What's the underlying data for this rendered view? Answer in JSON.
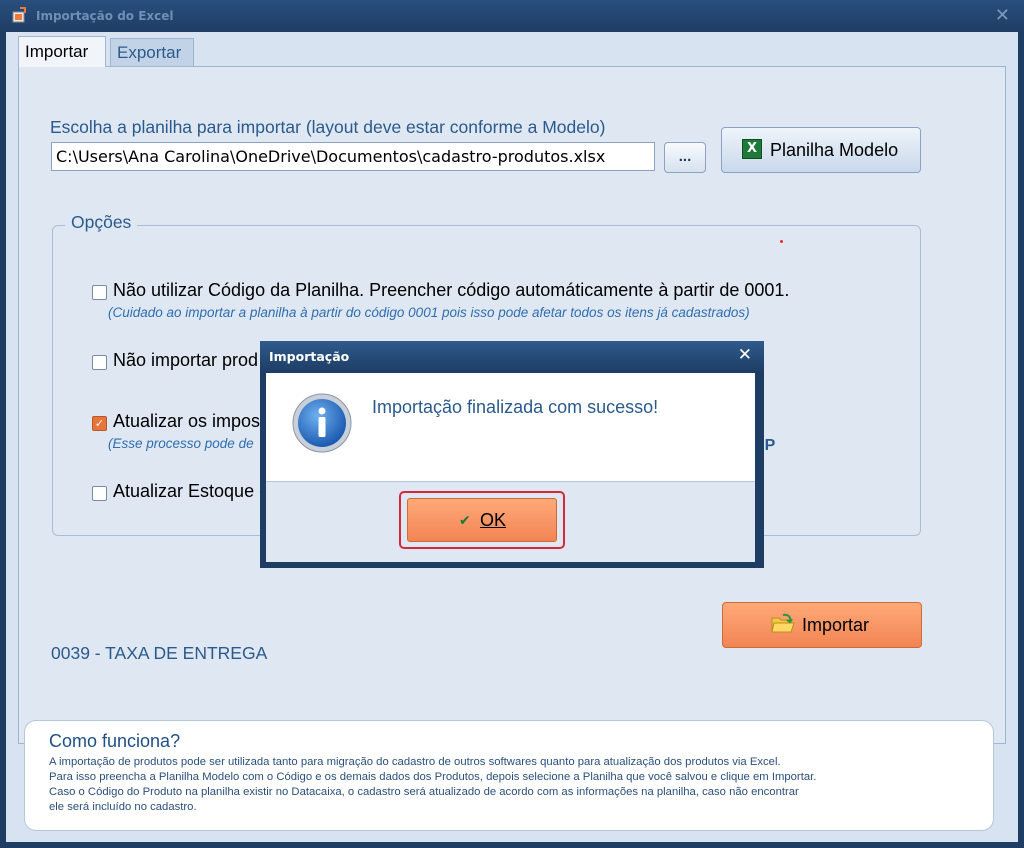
{
  "window": {
    "title": "Importação do Excel",
    "close_glyph": "✕"
  },
  "tabs": [
    {
      "label": "Importar",
      "active": true
    },
    {
      "label": "Exportar",
      "active": false
    }
  ],
  "import": {
    "choose_label": "Escolha a planilha para importar (layout deve estar conforme a Modelo)",
    "file_path": "C:\\Users\\Ana Carolina\\OneDrive\\Documentos\\cadastro-produtos.xlsx",
    "browse_label": "...",
    "model_button_label": "Planilha Modelo",
    "model_button_icon": "excel-icon"
  },
  "options": {
    "title": "Opções",
    "items": [
      {
        "label": "Não utilizar Código da Planilha. Preencher código automáticamente à partir de 0001.",
        "checked": false,
        "note": "(Cuidado ao importar a planilha à partir do código 0001 pois isso pode afetar todos os itens já cadastrados)"
      },
      {
        "label": "Não importar prod",
        "checked": false,
        "note": ""
      },
      {
        "label": "Atualizar os impos",
        "checked": true,
        "note": "(Esse processo pode de"
      },
      {
        "label": "Atualizar Estoque c",
        "checked": false,
        "note": ""
      }
    ],
    "tag": "SP"
  },
  "import_button_label": "Importar",
  "current_product": "0039 - TAXA DE ENTREGA",
  "help": {
    "title": "Como funciona?",
    "lines": [
      "A importação de produtos pode ser utilizada tanto para migração do cadastro de outros softwares quanto para atualização dos produtos via Excel.",
      "Para isso preencha a Planilha Modelo com o Código e os demais dados dos Produtos, depois selecione a Planilha que você salvou e clique em Importar.",
      "Caso o Código do Produto na planilha existir no Datacaixa, o cadastro será atualizado de acordo com as informações na planilha, caso não encontrar",
      "ele será incluído no cadastro."
    ]
  },
  "dialog": {
    "title": "Importação",
    "message": "Importação finalizada com sucesso!",
    "ok_label": "OK",
    "close_glyph": "✕",
    "icon": "info-icon"
  },
  "colors": {
    "accent_orange": "#f28454",
    "window_blue": "#1d3d64",
    "label_blue": "#2a5a8c",
    "highlight_red": "#d8283a"
  }
}
